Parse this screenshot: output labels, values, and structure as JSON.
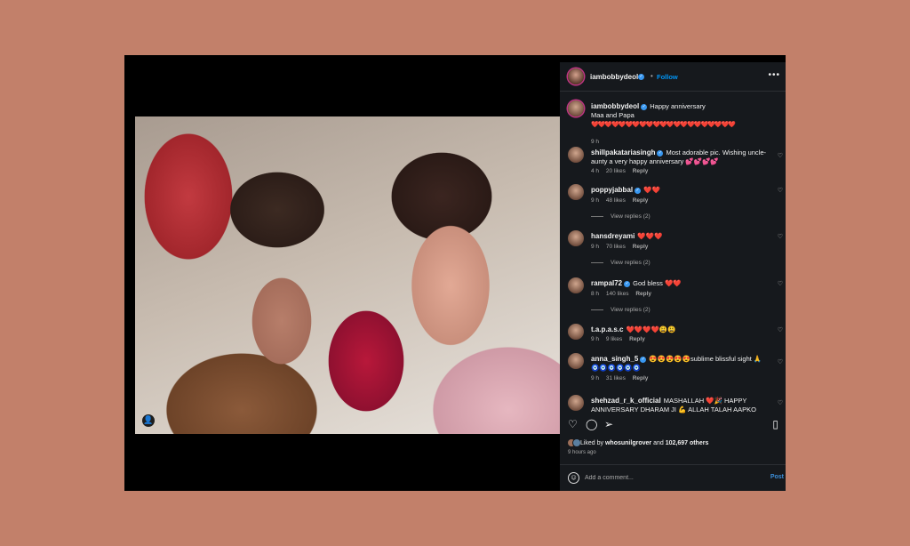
{
  "header": {
    "username": "iambobbydeol",
    "dot": "•",
    "follow_label": "Follow",
    "more_icon": "•••"
  },
  "caption": {
    "username": "iambobbydeol",
    "text": "Happy anniversary",
    "line2": "Maa and Papa",
    "hearts": "❤️❤️❤️❤️❤️❤️❤️❤️❤️❤️❤️❤️❤️❤️❤️❤️❤️❤️❤️❤️❤️",
    "time": "9 h"
  },
  "comments": [
    {
      "username": "shillpakatariasingh",
      "text": "Most adorable pic. Wishing uncle-aunty a very happy anniversary 💕💕💕💕",
      "time": "4 h",
      "likes": "20 likes",
      "reply": "Reply",
      "view_replies": ""
    },
    {
      "username": "poppyjabbal",
      "text": "❤️❤️",
      "time": "9 h",
      "likes": "48 likes",
      "reply": "Reply",
      "view_replies": "View replies (2)"
    },
    {
      "username": "hansdreyami",
      "text": "❤️❤️❤️",
      "time": "9 h",
      "likes": "70 likes",
      "reply": "Reply",
      "view_replies": "View replies (2)"
    },
    {
      "username": "rampal72",
      "text": "God bless ❤️❤️",
      "time": "8 h",
      "likes": "140 likes",
      "reply": "Reply",
      "view_replies": "View replies (2)"
    },
    {
      "username": "t.a.p.a.s.c",
      "text": "❤️❤️❤️❤️😩😩",
      "time": "9 h",
      "likes": "9 likes",
      "reply": "Reply",
      "view_replies": ""
    },
    {
      "username": "anna_singh_5",
      "text": "😍😍😍😍😍sublime blissful sight 🙏 🧿🧿🧿🧿🧿🧿",
      "time": "9 h",
      "likes": "31 likes",
      "reply": "Reply",
      "view_replies": ""
    },
    {
      "username": "shehzad_r_k_official",
      "text": "MASHALLAH ❤️🎉 HAPPY ANNIVERSARY DHARAM JI 💪 ALLAH TALAH AAPKO SEHAT YAFTA RAKHE AUR LAMBI UMAR RAZAT KARE ... AMEEN",
      "time": "",
      "likes": "",
      "reply": "",
      "view_replies": ""
    }
  ],
  "actions": {
    "like_icon": "heart-icon",
    "comment_icon": "comment-icon",
    "share_icon": "share-icon",
    "save_icon": "bookmark-icon"
  },
  "likes": {
    "prefix": "Liked by",
    "user": "whosunilgrover",
    "middle": "and",
    "count": "102,697 others"
  },
  "post_time": "9 hours ago",
  "add_comment": {
    "placeholder": "Add a comment...",
    "post_label": "Post"
  },
  "colors": {
    "background": "#c2806a",
    "panel": "#16191d",
    "accent": "#0095f6",
    "heart_red": "#ff3040"
  }
}
